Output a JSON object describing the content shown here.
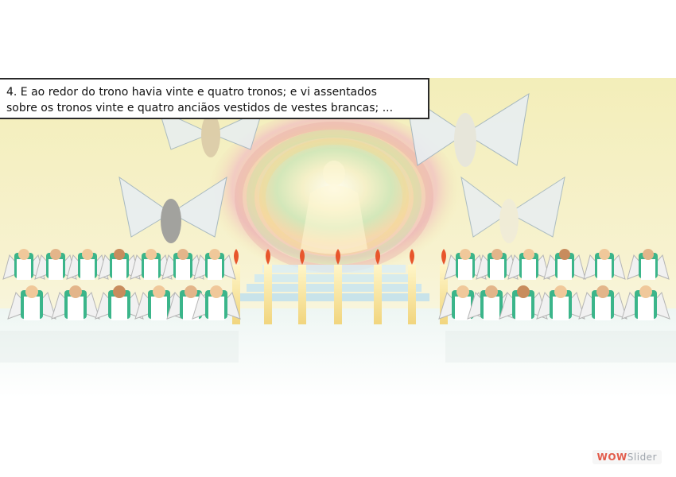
{
  "caption": {
    "line1": "4. E ao redor do trono havia vinte e quatro tronos; e vi assentados",
    "line2": "sobre os tronos vinte e quatro anciãos vestidos de vestes brancas; ..."
  },
  "watermark": {
    "part1": "WOW",
    "part2": "Slider"
  },
  "colors": {
    "caption_border": "#2a2a2a",
    "sky": "#f3eeb9",
    "rainbow_glow": "#f2c7c2",
    "throne_green": "#3bb58a",
    "flame": "#e8562c",
    "watermark_red": "#e25b4a",
    "watermark_grey": "#9ea4ac"
  }
}
